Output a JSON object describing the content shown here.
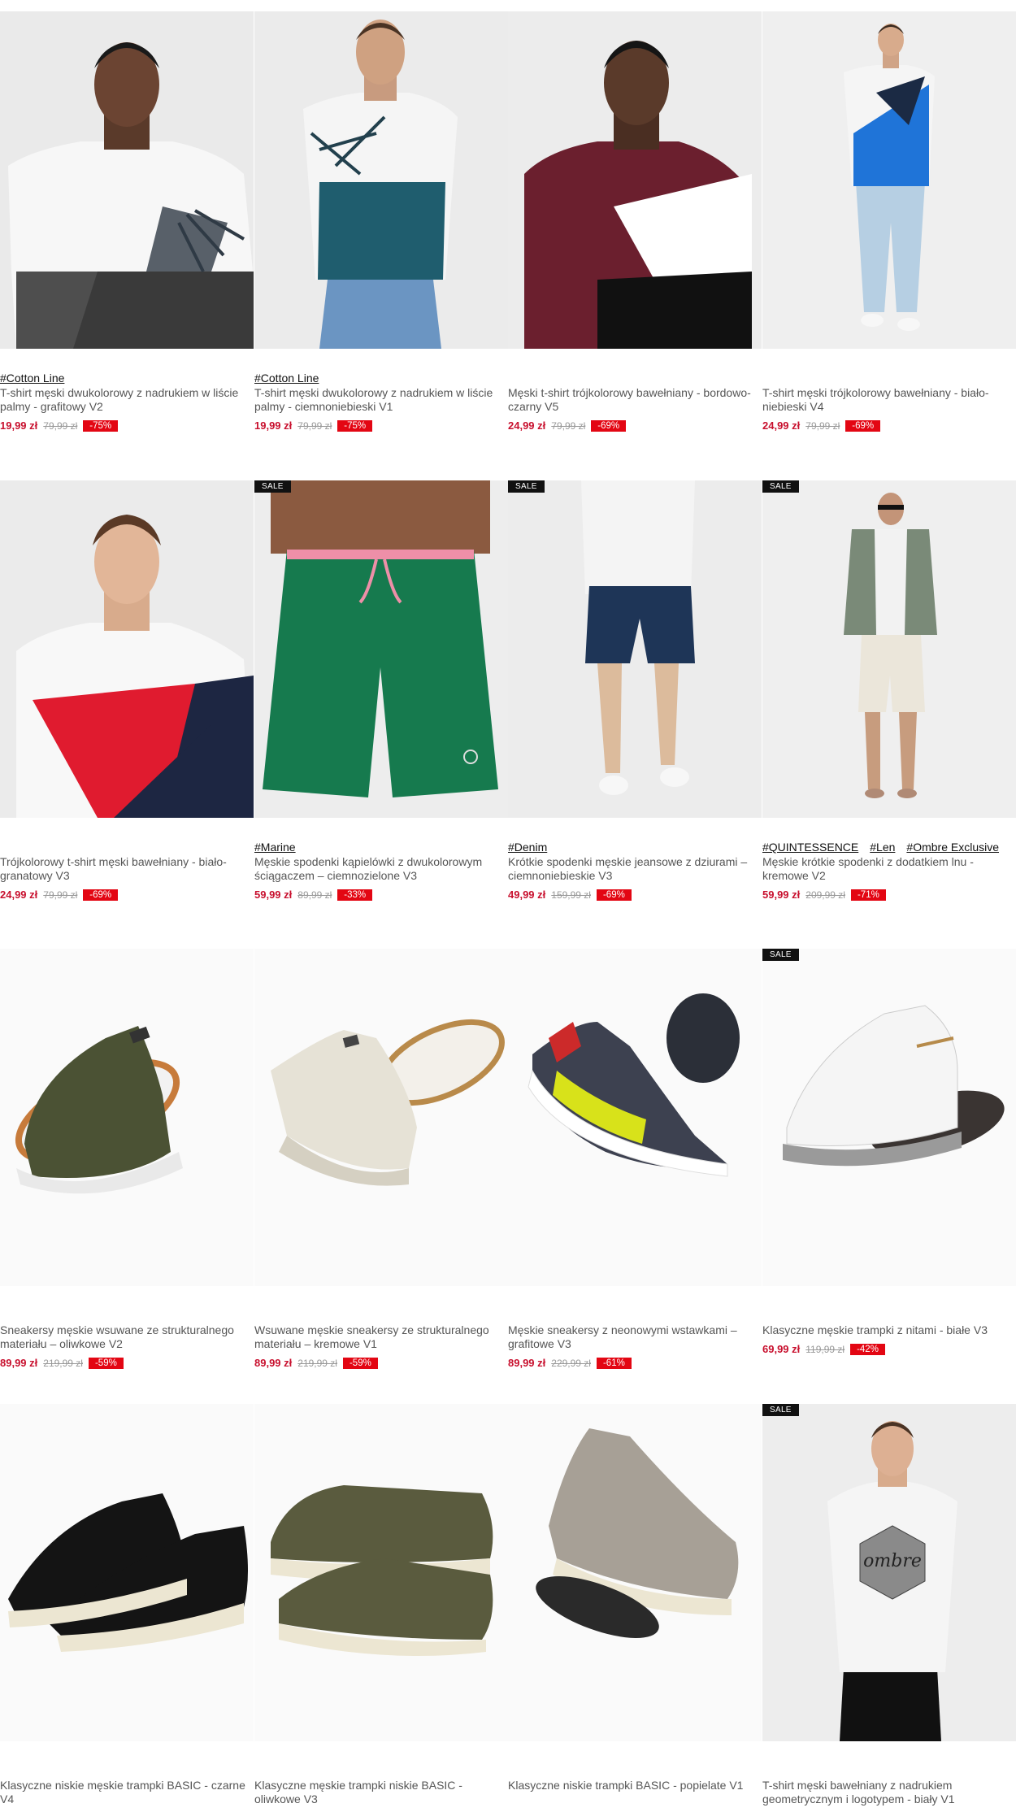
{
  "sale_label": "SALE",
  "products": [
    {
      "tags": [
        "#Cotton Line"
      ],
      "name": "T-shirt męski dwukolorowy z nadrukiem w liście palmy - grafitowy V2",
      "price": "19,99 zł",
      "old_price": "79,99 zł",
      "discount": "-75%",
      "sale": false
    },
    {
      "tags": [
        "#Cotton Line"
      ],
      "name": "T-shirt męski dwukolorowy z nadrukiem w liście palmy - ciemnoniebieski V1",
      "price": "19,99 zł",
      "old_price": "79,99 zł",
      "discount": "-75%",
      "sale": false
    },
    {
      "tags": [],
      "name": "Męski t-shirt trójkolorowy bawełniany - bordowo-czarny V5",
      "price": "24,99 zł",
      "old_price": "79,99 zł",
      "discount": "-69%",
      "sale": false
    },
    {
      "tags": [],
      "name": "T-shirt męski trójkolorowy bawełniany - biało-niebieski V4",
      "price": "24,99 zł",
      "old_price": "79,99 zł",
      "discount": "-69%",
      "sale": false
    },
    {
      "tags": [],
      "name": "Trójkolorowy t-shirt męski bawełniany - biało-granatowy V3",
      "price": "24,99 zł",
      "old_price": "79,99 zł",
      "discount": "-69%",
      "sale": false
    },
    {
      "tags": [
        "#Marine"
      ],
      "name": "Męskie spodenki kąpielówki z dwukolorowym ściągaczem – ciemnozielone V3",
      "price": "59,99 zł",
      "old_price": "89,99 zł",
      "discount": "-33%",
      "sale": true
    },
    {
      "tags": [
        "#Denim"
      ],
      "name": "Krótkie spodenki męskie jeansowe z dziurami – ciemnoniebieskie V3",
      "price": "49,99 zł",
      "old_price": "159,99 zł",
      "discount": "-69%",
      "sale": true
    },
    {
      "tags": [
        "#QUINTESSENCE",
        "#Len",
        "#Ombre Exclusive"
      ],
      "name": "Męskie krótkie spodenki z dodatkiem lnu - kremowe V2",
      "price": "59,99 zł",
      "old_price": "209,99 zł",
      "discount": "-71%",
      "sale": true
    },
    {
      "tags": [],
      "name": "Sneakersy męskie wsuwane ze strukturalnego materiału – oliwkowe V2",
      "price": "89,99 zł",
      "old_price": "219,99 zł",
      "discount": "-59%",
      "sale": false
    },
    {
      "tags": [],
      "name": "Wsuwane męskie sneakersy ze strukturalnego materiału – kremowe V1",
      "price": "89,99 zł",
      "old_price": "219,99 zł",
      "discount": "-59%",
      "sale": false
    },
    {
      "tags": [],
      "name": "Męskie sneakersy z neonowymi wstawkami – grafitowe V3",
      "price": "89,99 zł",
      "old_price": "229,99 zł",
      "discount": "-61%",
      "sale": false
    },
    {
      "tags": [],
      "name": "Klasyczne męskie trampki z nitami - białe V3",
      "price": "69,99 zł",
      "old_price": "119,99 zł",
      "discount": "-42%",
      "sale": true
    },
    {
      "tags": [],
      "name": "Klasyczne niskie męskie trampki BASIC - czarne V4",
      "price": "",
      "old_price": "",
      "discount": "",
      "sale": false
    },
    {
      "tags": [],
      "name": "Klasyczne męskie trampki niskie BASIC - oliwkowe V3",
      "price": "",
      "old_price": "",
      "discount": "",
      "sale": false
    },
    {
      "tags": [],
      "name": "Klasyczne niskie trampki BASIC - popielate V1",
      "price": "",
      "old_price": "",
      "discount": "",
      "sale": false
    },
    {
      "tags": [],
      "name": "T-shirt męski bawełniany z nadrukiem geometrycznym i logotypem - biały V1",
      "price": "",
      "old_price": "",
      "discount": "",
      "sale": true
    }
  ],
  "print_logo_text": "ombre"
}
